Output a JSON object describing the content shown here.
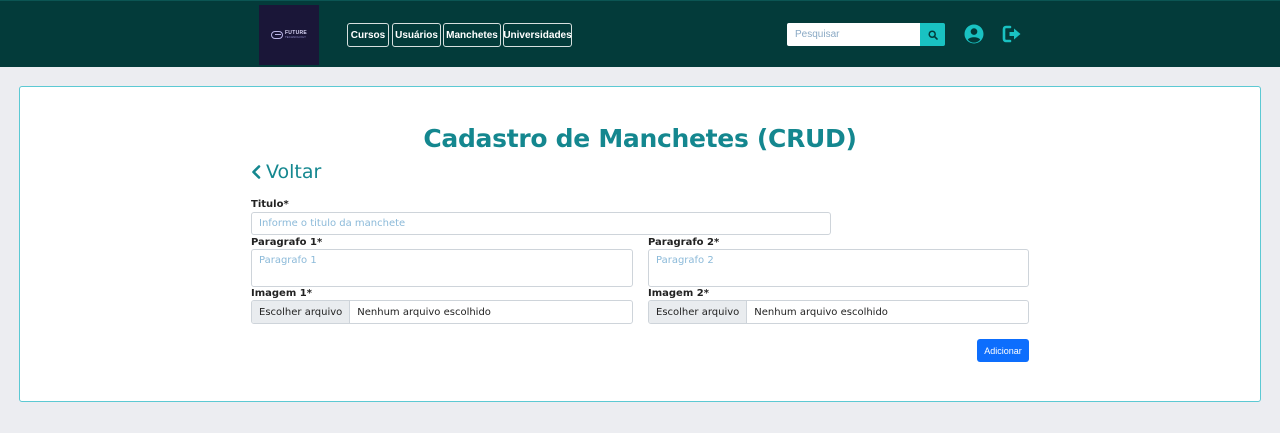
{
  "brand": {
    "name": "FUTURE",
    "tagline": "TECHNOLOGY"
  },
  "nav": {
    "items": [
      {
        "label": "Cursos"
      },
      {
        "label": "Usuários"
      },
      {
        "label": "Manchetes"
      },
      {
        "label": "Universidades"
      }
    ]
  },
  "search": {
    "placeholder": "Pesquisar",
    "icon": "search-icon"
  },
  "header_icons": {
    "user": "user-circle-icon",
    "logout": "logout-icon"
  },
  "page": {
    "title": "Cadastro de Manchetes (CRUD)",
    "back_label": "Voltar"
  },
  "form": {
    "titulo": {
      "label": "Titulo*",
      "placeholder": "Informe o titulo da manchete"
    },
    "paragrafo1": {
      "label": "Paragrafo 1*",
      "placeholder": "Paragrafo 1"
    },
    "paragrafo2": {
      "label": "Paragrafo 2*",
      "placeholder": "Paragrafo 2"
    },
    "imagem1": {
      "label": "Imagem 1*",
      "button": "Escolher arquivo",
      "status": "Nenhum arquivo escolhido"
    },
    "imagem2": {
      "label": "Imagem 2*",
      "button": "Escolher arquivo",
      "status": "Nenhum arquivo escolhido"
    },
    "submit": "Adicionar"
  },
  "colors": {
    "navbar": "#033b3a",
    "accent": "#19c2c2",
    "title": "#14878f",
    "primary_button": "#0d6efd"
  }
}
